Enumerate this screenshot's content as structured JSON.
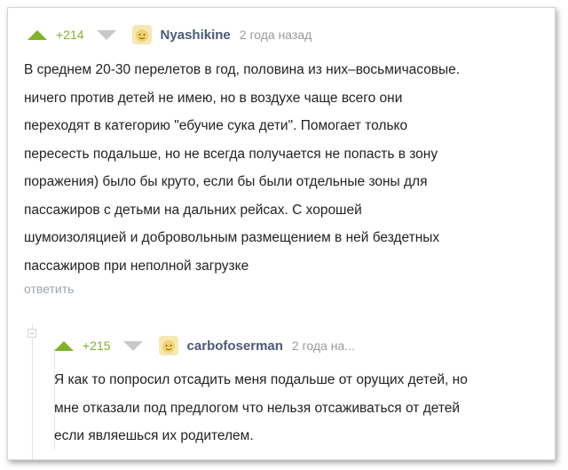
{
  "comments": [
    {
      "rating": "+214",
      "author": "Nyashikine",
      "time": "2 года назад",
      "text": "В среднем 20-30 перелетов в год, половина из них–восьмичасовые.\nничего против детей не имею, но в воздухе чаще всего они\nпереходят в категорию \"ебучие сука дети\". Помогает только\nпересесть подальше, но не всегда получается не попасть в зону\nпоражения) было бы круто, если бы были отдельные зоны для\nпассажиров с детьми на дальних рейсах. С хорошей\nшумоизоляцией и добровольным размещением в ней бездетных\nпассажиров при неполной загрузке",
      "reply_label": "ответить"
    },
    {
      "rating": "+215",
      "author": "carbofoserman",
      "time": "2 года на...",
      "text": "Я как то попросил отсадить меня подальше от орущих детей, но\nмне отказали под предлогом что нельзя отсаживаться от детей\nесли являешься их родителем."
    }
  ],
  "colors": {
    "upvote": "#7fb32a",
    "downvote": "#c9c9c9",
    "username": "#4a5a78",
    "reply_link": "#9aa5b2",
    "avatar_bg": "#f3d36b"
  },
  "icons": {
    "upvote": "triangle-up-icon",
    "downvote": "triangle-down-icon",
    "avatar": "avatar-face-icon",
    "collapse": "collapse-thread-icon"
  }
}
